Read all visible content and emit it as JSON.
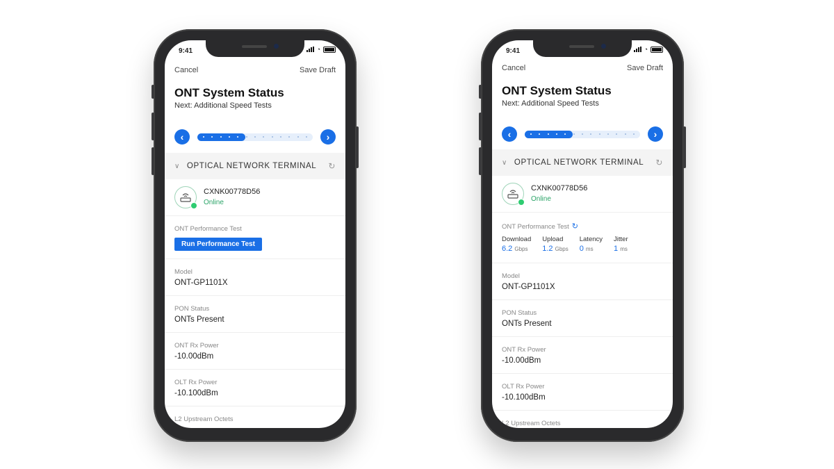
{
  "status_bar": {
    "time": "9:41"
  },
  "screens": [
    {
      "nav": {
        "cancel": "Cancel",
        "save_draft": "Save Draft"
      },
      "title": "ONT System Status",
      "subtitle": "Next: Additional Speed Tests",
      "stepper": {
        "current_step": 5,
        "total_steps": 13
      },
      "section": {
        "title": "OPTICAL NETWORK TERMINAL"
      },
      "device": {
        "serial": "CXNK00778D56",
        "status": "Online"
      },
      "performance": {
        "label": "ONT Performance Test",
        "run_button": "Run Performance Test"
      },
      "rows": [
        {
          "label": "Model",
          "value": "ONT-GP1101X"
        },
        {
          "label": "PON Status",
          "value": "ONTs Present"
        },
        {
          "label": "ONT Rx Power",
          "value": "-10.00dBm"
        },
        {
          "label": "OLT Rx Power",
          "value": "-10.100dBm"
        },
        {
          "label": "L2 Upstream Octets",
          "value": ""
        }
      ]
    },
    {
      "nav": {
        "cancel": "Cancel",
        "save_draft": "Save Draft"
      },
      "title": "ONT System Status",
      "subtitle": "Next: Additional Speed Tests",
      "stepper": {
        "current_step": 5,
        "total_steps": 13
      },
      "section": {
        "title": "OPTICAL NETWORK TERMINAL"
      },
      "device": {
        "serial": "CXNK00778D56",
        "status": "Online"
      },
      "performance": {
        "label": "ONT Performance Test",
        "results": [
          {
            "name": "Download",
            "value": "6.2",
            "unit": "Gbps"
          },
          {
            "name": "Upload",
            "value": "1.2",
            "unit": "Gbps"
          },
          {
            "name": "Latency",
            "value": "0",
            "unit": "ms"
          },
          {
            "name": "Jitter",
            "value": "1",
            "unit": "ms"
          }
        ]
      },
      "rows": [
        {
          "label": "Model",
          "value": "ONT-GP1101X"
        },
        {
          "label": "PON Status",
          "value": "ONTs Present"
        },
        {
          "label": "ONT Rx Power",
          "value": "-10.00dBm"
        },
        {
          "label": "OLT Rx Power",
          "value": "-10.100dBm"
        },
        {
          "label": "L2 Upstream Octets",
          "value": ""
        }
      ]
    }
  ],
  "colors": {
    "accent": "#1a6fe6",
    "online": "#2ba468",
    "online_dot": "#2ecc71"
  }
}
